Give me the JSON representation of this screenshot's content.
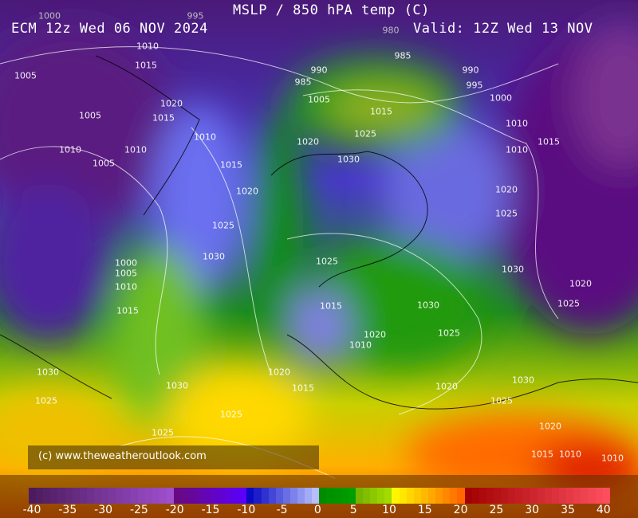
{
  "header": {
    "title": "MSLP / 850 hPA temp (C)",
    "run": "ECM 12z Wed 06 NOV 2024",
    "valid": "Valid: 12Z Wed 13 NOV"
  },
  "credit": "(c) www.theweatheroutlook.com",
  "colorbar": {
    "ticks": [
      "-40",
      "-35",
      "-30",
      "-25",
      "-20",
      "-15",
      "-10",
      "-5",
      "0",
      "5",
      "10",
      "15",
      "20",
      "25",
      "30",
      "35",
      "40"
    ],
    "range": [
      -40,
      40
    ],
    "colors": {
      "cold_purple": "#5a1a6a",
      "purple": "#6a10c0",
      "blue": "#3030d0",
      "light_blue": "#a0a8ff",
      "green": "#009a00",
      "yellow_green": "#90d000",
      "yellow": "#ffee00",
      "orange": "#ff7a00",
      "red": "#c00000"
    }
  },
  "isobar_labels": [
    "1000",
    "995",
    "980",
    "1010",
    "1015",
    "1005",
    "1020",
    "1005",
    "1015",
    "1010",
    "1010",
    "1010",
    "1005",
    "1015",
    "1020",
    "1025",
    "1030",
    "1000",
    "1005",
    "1010",
    "1015",
    "985",
    "990",
    "985",
    "995",
    "990",
    "1000",
    "1005",
    "1015",
    "1010",
    "1020",
    "1025",
    "1010",
    "1015",
    "1030",
    "1020",
    "1025",
    "1025",
    "1030",
    "1020",
    "1025",
    "1015",
    "1030",
    "1020",
    "1025",
    "1010",
    "1030",
    "1020",
    "1030",
    "1015",
    "1020",
    "1025",
    "1030",
    "1025",
    "1025",
    "1025",
    "1020",
    "1015",
    "1010",
    "1010"
  ]
}
